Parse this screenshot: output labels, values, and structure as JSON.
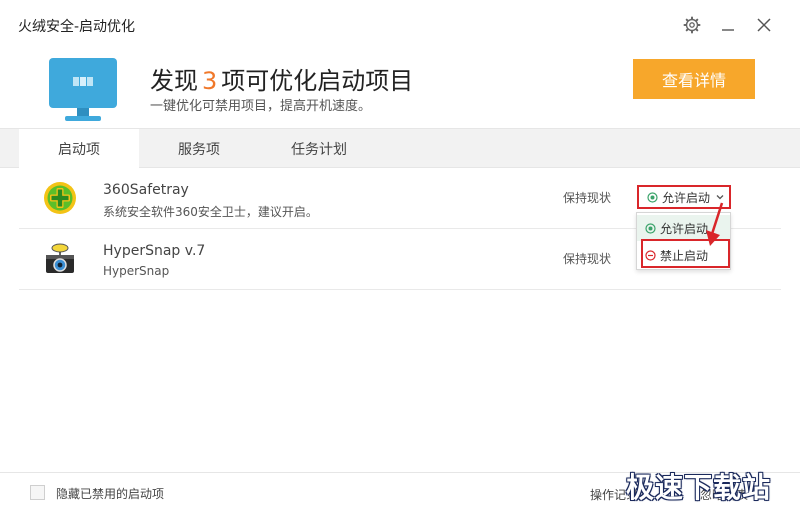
{
  "window": {
    "title": "火绒安全-启动优化",
    "icons": [
      "gear-icon",
      "minimize-icon",
      "close-icon"
    ]
  },
  "header": {
    "headline_prefix": "发现",
    "count": "3",
    "headline_suffix": "项可优化启动项目",
    "subline": "一键优化可禁用项目，提高开机速度。",
    "detail_button": "查看详情",
    "accent_color": "#f7a72b",
    "count_color": "#f0782a"
  },
  "tabs": [
    {
      "label": "启动项",
      "active": true
    },
    {
      "label": "服务项",
      "active": false
    },
    {
      "label": "任务计划",
      "active": false
    }
  ],
  "rows": [
    {
      "name": "360Safetray",
      "desc": "系统安全软件360安全卫士，建议开启。",
      "status": "保持现状",
      "selected": "允许启动",
      "icon": "360-safe-icon"
    },
    {
      "name": "HyperSnap v.7",
      "desc": "HyperSnap",
      "status": "保持现状",
      "selected": "允许启动",
      "icon": "hypersnap-camera-icon"
    }
  ],
  "dropdown": {
    "options": [
      "允许启动",
      "禁止启动"
    ]
  },
  "footer": {
    "checkbox_label": "隐藏已禁用的启动项",
    "link1": "操作记录",
    "link2": "忽略列表"
  },
  "watermark": "极速下载站",
  "colors": {
    "highlight_red": "#d9262a",
    "allow_green": "#3aa36a"
  }
}
